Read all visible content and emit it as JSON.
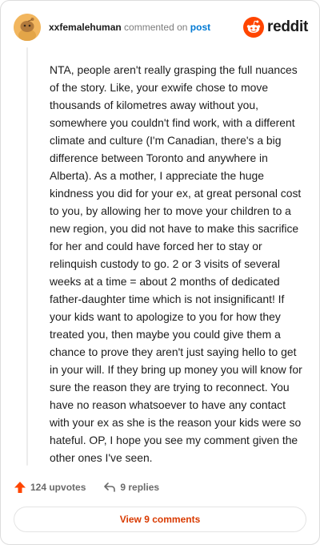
{
  "header": {
    "username": "xxfemalehuman",
    "commented_text": "commented on",
    "post_link_label": "post",
    "brand": "reddit",
    "avatar_icon": "snoo-avatar-icon",
    "brand_icon": "reddit-logo-icon"
  },
  "comment": {
    "body": "NTA, people aren't really grasping the full nuances of the story. Like, your exwife chose to move thousands of kilometres away without you, somewhere you couldn't find work, with a different climate and culture (I'm Canadian, there's a big difference between Toronto and anywhere in Alberta). As a mother, I appreciate the huge kindness you did for your ex, at great personal cost to you, by allowing her to move your children to a new region, you did not have to make this sacrifice for her and could have forced her to stay or relinquish custody to go. 2 or 3 visits of several weeks at a time = about 2 months of dedicated father-daughter time which is not insignificant! If your kids want to apologize to you for how they treated you, then maybe you could give them a chance to prove they aren't just saying hello to get in your will. If they bring up money you will know for sure the reason they are trying to reconnect. You have no reason whatsoever to have any contact with your ex as she is the reason your kids were so hateful. OP, I hope you see my comment given the other ones I've seen."
  },
  "actions": {
    "upvotes_label": "124 upvotes",
    "replies_label": "9 replies",
    "upvote_icon": "upvote-arrow-icon",
    "reply_icon": "reply-arrow-icon"
  },
  "view_comments_label": "View 9 comments",
  "colors": {
    "accent": "#d93a00",
    "link": "#0079d3",
    "brand_orange": "#ff4500",
    "muted": "#7c7c7c"
  }
}
